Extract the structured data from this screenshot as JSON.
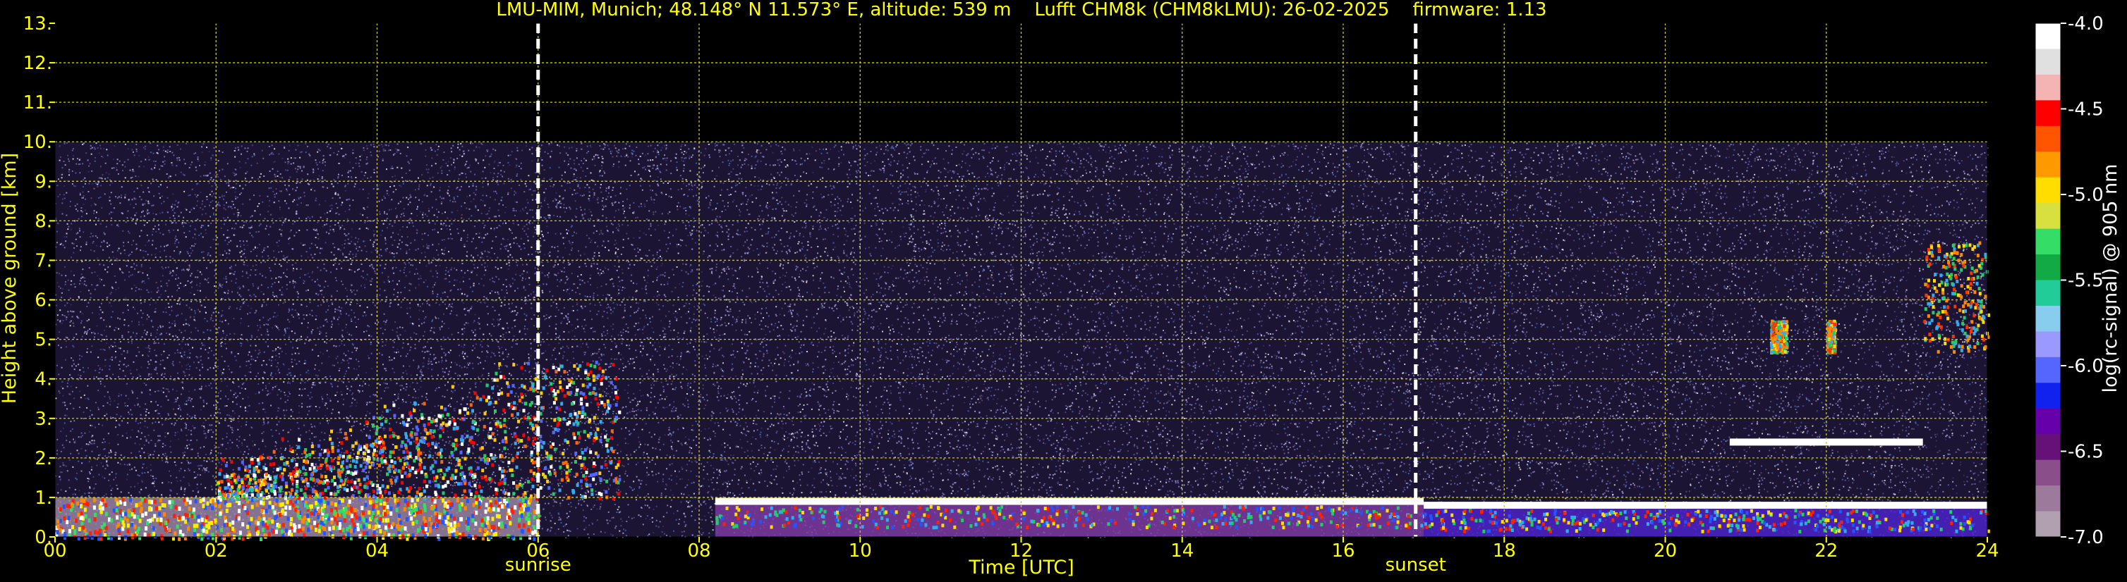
{
  "chart_data": {
    "type": "heatmap",
    "title": "LMU-MIM, Munich; 48.148° N 11.573° E, altitude: 539 m    Lufft CHM8k (CHM8kLMU): 26-02-2025    firmware: 1.13",
    "xlabel": "Time [UTC]",
    "ylabel": "Height above ground [km]",
    "xlim": [
      0,
      24
    ],
    "ylim": [
      0,
      13
    ],
    "x_ticks": [
      "00",
      "02",
      "04",
      "06",
      "08",
      "10",
      "12",
      "14",
      "16",
      "18",
      "20",
      "22",
      "24"
    ],
    "y_ticks": [
      "0.",
      "1.",
      "2.",
      "3.",
      "4.",
      "5.",
      "6.",
      "7.",
      "8.",
      "9.",
      "10.",
      "11.",
      "12.",
      "13."
    ],
    "grid": true,
    "colorbar": {
      "label": "log(rc-signal) @ 905 nm",
      "range": [
        -7.0,
        -4.0
      ],
      "ticks": [
        "-4.0",
        "-4.5",
        "-5.0",
        "-5.5",
        "-6.0",
        "-6.5",
        "-7.0"
      ],
      "colors": [
        "#ffffff",
        "#e0e0e0",
        "#f4b4b4",
        "#ff0000",
        "#ff5500",
        "#ff9900",
        "#ffdd00",
        "#d8e040",
        "#33dd66",
        "#11aa44",
        "#22cc99",
        "#88ccee",
        "#9999ff",
        "#5566ff",
        "#1122ee",
        "#6600aa",
        "#661177",
        "#8a4f8a",
        "#9c7a9c",
        "#b0a0b0"
      ]
    },
    "annotations": [
      {
        "label": "sunrise",
        "x": 6.0
      },
      {
        "label": "sunset",
        "x": 16.9
      }
    ],
    "signal_ceiling_km": 10.0,
    "features": [
      {
        "kind": "boundary-layer",
        "x_range": [
          0,
          6
        ],
        "height_km": [
          0,
          1.0
        ]
      },
      {
        "kind": "aerosol-plume",
        "x_range": [
          2.0,
          7.0
        ],
        "height_km": [
          1.0,
          4.5
        ]
      },
      {
        "kind": "cloud-base",
        "x_range": [
          8.2,
          17.0
        ],
        "height_km": 0.9
      },
      {
        "kind": "cloud-base",
        "x_range": [
          17.0,
          24
        ],
        "height_km": 0.8
      },
      {
        "kind": "cloud",
        "x_range": [
          21.3,
          21.5
        ],
        "height_km": [
          4.7,
          5.5
        ]
      },
      {
        "kind": "cloud",
        "x_range": [
          22.0,
          22.1
        ],
        "height_km": [
          4.7,
          5.5
        ]
      },
      {
        "kind": "cloud",
        "x_range": [
          23.2,
          24
        ],
        "height_km": [
          4.7,
          7.5
        ]
      },
      {
        "kind": "cloud-layer",
        "x_range": [
          20.8,
          23.2
        ],
        "height_km": 2.4
      }
    ]
  }
}
